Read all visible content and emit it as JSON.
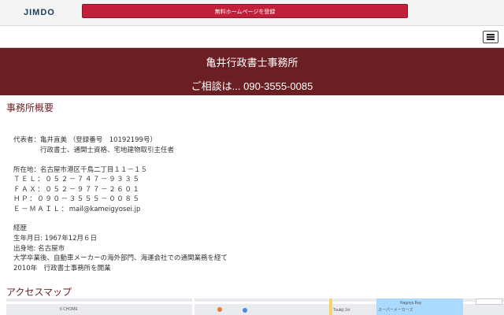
{
  "jimdo_bar": {
    "logo": "JIMDO",
    "register_button": "無料ホームページを登録"
  },
  "header": {
    "title": "亀井行政書士事務所",
    "contact": "ご相談は... 090-3555-0085"
  },
  "overview": {
    "title": "事務所概要",
    "rep_line1": "代表者：亀井直美 （登録番号　10192199号）",
    "rep_line2": "行政書士、通関士資格、宅地建物取引主任者",
    "address": "所在地：名古屋市港区千鳥二丁目１１－１５",
    "tel": "ＴＥＬ：０５２－７４７－９３３５",
    "fax": "ＦＡＸ：０５２－９７７－２６０１",
    "hp": "ＨＰ：０９０－３５５５－００８５",
    "email_label": "Ｅ－ＭＡＩＬ：",
    "email": "mail@kameigyosei.jp",
    "career_title": "経歴",
    "birth": "生年月日: 1967年12月６日",
    "birthplace": "出身地: 名古屋市",
    "career1": "大学卒業後、自動車メーカーの海外部門、海運会社での通関業務を経て",
    "career2": "2010年　行政書士事務所を開業"
  },
  "access": {
    "title": "アクセスマップ",
    "map_labels": [
      "6 CHOME",
      "Nagoya Bay",
      "スーパーメーカーズ",
      "Tsukiji Jct"
    ]
  }
}
